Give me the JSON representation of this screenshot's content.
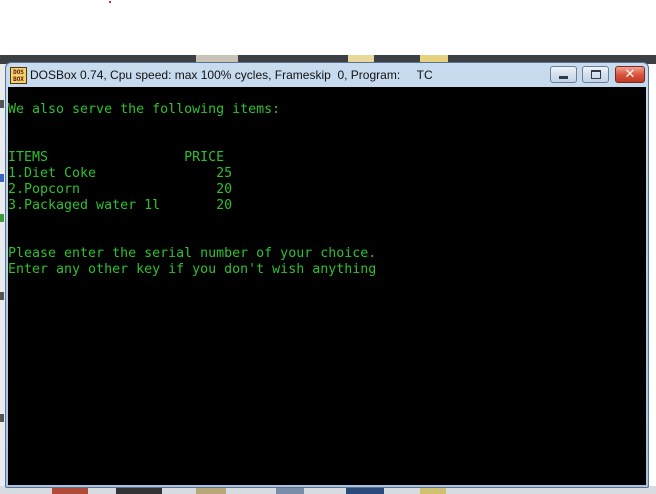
{
  "window": {
    "title": "DOSBox 0.74, Cpu speed: max 100% cycles, Frameskip  0, Program:     TC",
    "icon_text": "DOS BOX",
    "controls": [
      "minimize-icon",
      "maximize-icon",
      "close-icon"
    ]
  },
  "console": {
    "text_color": "#2fc02f",
    "background": "#000000",
    "intro": "We also serve the following items:",
    "header": "ITEMS                 PRICE",
    "items": [
      "1.Diet Coke               25",
      "2.Popcorn                 20",
      "3.Packaged water 1l       20"
    ],
    "prompt_line1": "Please enter the serial number of your choice.",
    "prompt_line2": "Enter any other key if you don't wish anything"
  }
}
